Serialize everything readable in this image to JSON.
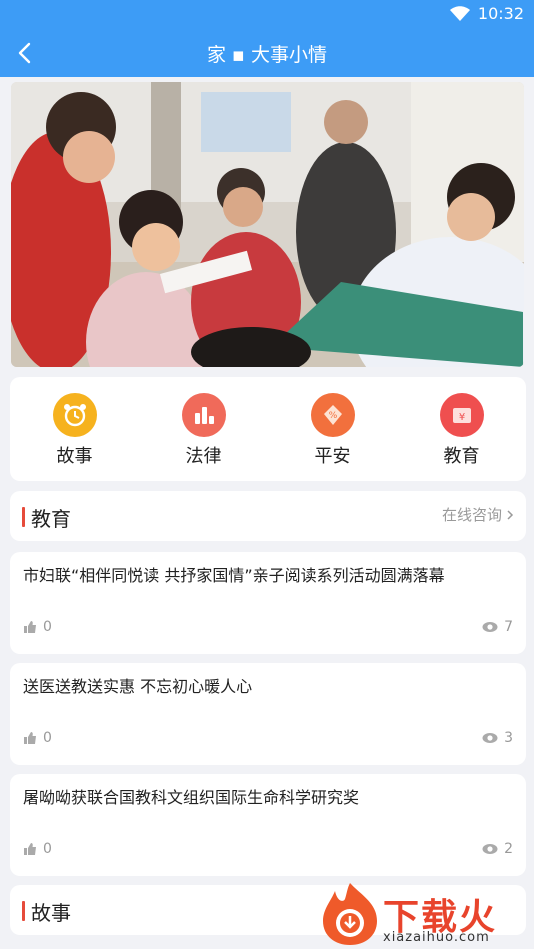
{
  "status_bar": {
    "time": "10:32"
  },
  "header": {
    "title": "家 ▪ 大事小情"
  },
  "categories": [
    {
      "label": "故事",
      "icon": "alarm-clock-icon",
      "color": "#f6b21e"
    },
    {
      "label": "法律",
      "icon": "bar-chart-icon",
      "color": "#f06a5a"
    },
    {
      "label": "平安",
      "icon": "discount-tag-icon",
      "color": "#f2703d"
    },
    {
      "label": "教育",
      "icon": "wallet-yuan-icon",
      "color": "#ef4f4f"
    }
  ],
  "sections": {
    "education": {
      "title": "教育",
      "more": "在线咨询"
    },
    "story": {
      "title": "故事"
    }
  },
  "articles": [
    {
      "title": "市妇联“相伴同悦读 共抒家国情”亲子阅读系列活动圆满落幕",
      "likes": "0",
      "views": "7"
    },
    {
      "title": "送医送教送实惠 不忘初心暖人心",
      "likes": "0",
      "views": "3"
    },
    {
      "title": "屠呦呦获联合国教科文组织国际生命科学研究奖",
      "likes": "0",
      "views": "2"
    }
  ],
  "watermark": {
    "text": "下载火",
    "url": "xiazaihuo.com"
  },
  "colors": {
    "primary": "#3d9cf6",
    "accent": "#e64b3b",
    "background": "#f1f2f6"
  }
}
